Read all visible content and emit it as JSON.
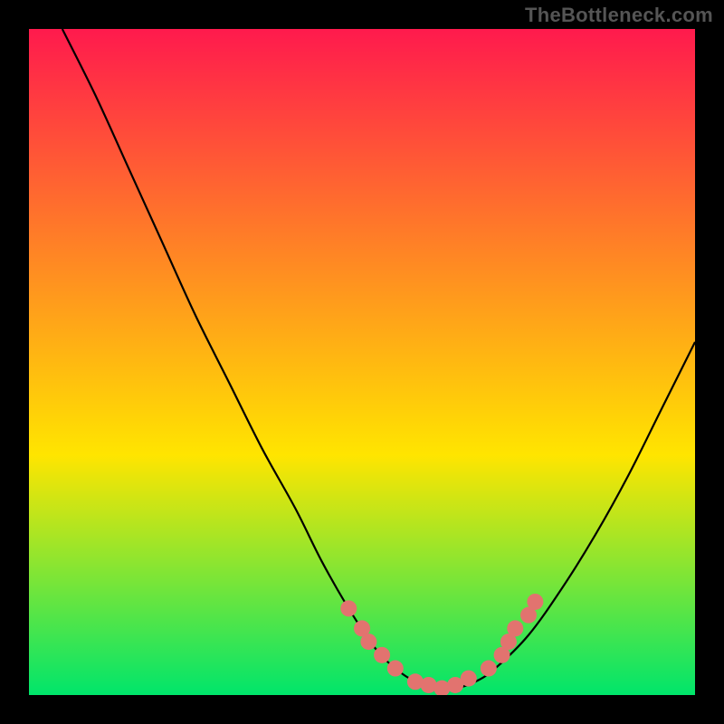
{
  "watermark": "TheBottleneck.com",
  "chart_data": {
    "type": "line",
    "title": "",
    "xlabel": "",
    "ylabel": "",
    "xlim": [
      0,
      100
    ],
    "ylim": [
      0,
      100
    ],
    "background_gradient": {
      "top": "#ff1a4d",
      "mid": "#ffe500",
      "bottom": "#00e56b"
    },
    "curve": {
      "x": [
        5,
        10,
        15,
        20,
        25,
        30,
        35,
        40,
        44,
        48,
        52,
        55,
        58,
        61,
        64,
        67,
        70,
        75,
        80,
        85,
        90,
        95,
        100
      ],
      "y": [
        100,
        90,
        79,
        68,
        57,
        47,
        37,
        28,
        20,
        13,
        7,
        4,
        2,
        1,
        1,
        2,
        4,
        9,
        16,
        24,
        33,
        43,
        53
      ]
    },
    "highlight_points": {
      "color": "#e2736f",
      "radius": 9,
      "points": [
        {
          "x": 48,
          "y": 13
        },
        {
          "x": 50,
          "y": 10
        },
        {
          "x": 51,
          "y": 8
        },
        {
          "x": 53,
          "y": 6
        },
        {
          "x": 55,
          "y": 4
        },
        {
          "x": 58,
          "y": 2
        },
        {
          "x": 60,
          "y": 1.5
        },
        {
          "x": 62,
          "y": 1
        },
        {
          "x": 64,
          "y": 1.5
        },
        {
          "x": 66,
          "y": 2.5
        },
        {
          "x": 69,
          "y": 4
        },
        {
          "x": 71,
          "y": 6
        },
        {
          "x": 72,
          "y": 8
        },
        {
          "x": 73,
          "y": 10
        },
        {
          "x": 75,
          "y": 12
        },
        {
          "x": 76,
          "y": 14
        }
      ]
    }
  }
}
